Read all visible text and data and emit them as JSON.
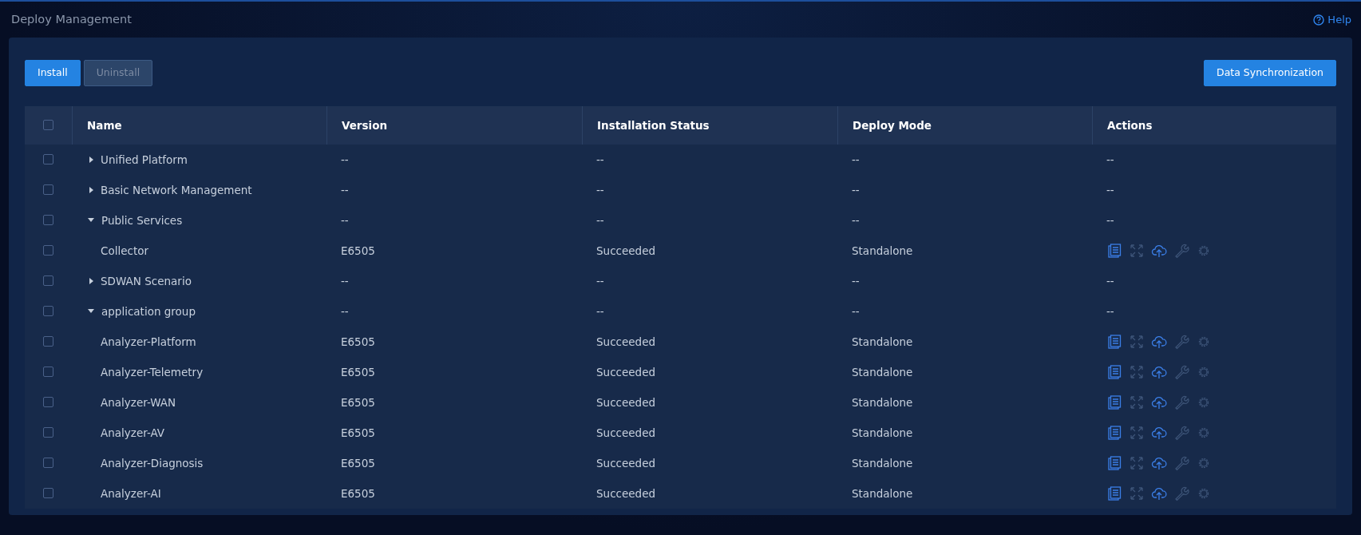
{
  "page": {
    "title": "Deploy Management",
    "help": "Help"
  },
  "toolbar": {
    "buttons": [
      {
        "label": "Install",
        "disabled": false
      },
      {
        "label": "Uninstall",
        "disabled": true
      }
    ],
    "sync_button": "Data Synchronization"
  },
  "table": {
    "header_checked": false,
    "columns": [
      "Name",
      "Version",
      "Installation Status",
      "Deploy Mode",
      "Actions"
    ],
    "rows": [
      {
        "name": "Unified Platform",
        "version": "--",
        "status": "--",
        "mode": "--",
        "actions_text": "--",
        "checked": false,
        "expanded": false
      },
      {
        "name": "Basic Network Management",
        "version": "--",
        "status": "--",
        "mode": "--",
        "actions_text": "--",
        "checked": false,
        "expanded": false
      },
      {
        "name": "Public Services",
        "version": "--",
        "status": "--",
        "mode": "--",
        "actions_text": "--",
        "checked": false,
        "expanded": true,
        "children": [
          {
            "name": "Collector",
            "version": "E6505",
            "status": "Succeeded",
            "mode": "Standalone",
            "checked": false,
            "actions": [
              {
                "kind": "document",
                "disabled": false
              },
              {
                "kind": "expand",
                "disabled": true
              },
              {
                "kind": "upload",
                "disabled": false
              },
              {
                "kind": "wrench",
                "disabled": true
              },
              {
                "kind": "gear",
                "disabled": true
              }
            ]
          }
        ]
      },
      {
        "name": "SDWAN Scenario",
        "version": "--",
        "status": "--",
        "mode": "--",
        "actions_text": "--",
        "checked": false,
        "expanded": false
      },
      {
        "name": "application group",
        "version": "--",
        "status": "--",
        "mode": "--",
        "actions_text": "--",
        "checked": false,
        "expanded": true,
        "children": [
          {
            "name": "Analyzer-Platform",
            "version": "E6505",
            "status": "Succeeded",
            "mode": "Standalone",
            "checked": false,
            "actions": [
              {
                "kind": "document",
                "disabled": false
              },
              {
                "kind": "expand",
                "disabled": true
              },
              {
                "kind": "upload",
                "disabled": false
              },
              {
                "kind": "wrench",
                "disabled": true
              },
              {
                "kind": "gear",
                "disabled": true
              }
            ]
          },
          {
            "name": "Analyzer-Telemetry",
            "version": "E6505",
            "status": "Succeeded",
            "mode": "Standalone",
            "checked": false,
            "actions": [
              {
                "kind": "document",
                "disabled": false
              },
              {
                "kind": "expand",
                "disabled": true
              },
              {
                "kind": "upload",
                "disabled": false
              },
              {
                "kind": "wrench",
                "disabled": true
              },
              {
                "kind": "gear",
                "disabled": true
              }
            ]
          },
          {
            "name": "Analyzer-WAN",
            "version": "E6505",
            "status": "Succeeded",
            "mode": "Standalone",
            "checked": false,
            "actions": [
              {
                "kind": "document",
                "disabled": false
              },
              {
                "kind": "expand",
                "disabled": true
              },
              {
                "kind": "upload",
                "disabled": false
              },
              {
                "kind": "wrench",
                "disabled": true
              },
              {
                "kind": "gear",
                "disabled": true
              }
            ]
          },
          {
            "name": "Analyzer-AV",
            "version": "E6505",
            "status": "Succeeded",
            "mode": "Standalone",
            "checked": false,
            "actions": [
              {
                "kind": "document",
                "disabled": false
              },
              {
                "kind": "expand",
                "disabled": true
              },
              {
                "kind": "upload",
                "disabled": false
              },
              {
                "kind": "wrench",
                "disabled": true
              },
              {
                "kind": "gear",
                "disabled": true
              }
            ]
          },
          {
            "name": "Analyzer-Diagnosis",
            "version": "E6505",
            "status": "Succeeded",
            "mode": "Standalone",
            "checked": false,
            "actions": [
              {
                "kind": "document",
                "disabled": false
              },
              {
                "kind": "expand",
                "disabled": true
              },
              {
                "kind": "upload",
                "disabled": false
              },
              {
                "kind": "wrench",
                "disabled": true
              },
              {
                "kind": "gear",
                "disabled": true
              }
            ]
          },
          {
            "name": "Analyzer-AI",
            "version": "E6505",
            "status": "Succeeded",
            "mode": "Standalone",
            "checked": false,
            "actions": [
              {
                "kind": "document",
                "disabled": false
              },
              {
                "kind": "expand",
                "disabled": true
              },
              {
                "kind": "upload",
                "disabled": false
              },
              {
                "kind": "wrench",
                "disabled": true
              },
              {
                "kind": "gear",
                "disabled": true
              }
            ]
          }
        ]
      }
    ]
  }
}
